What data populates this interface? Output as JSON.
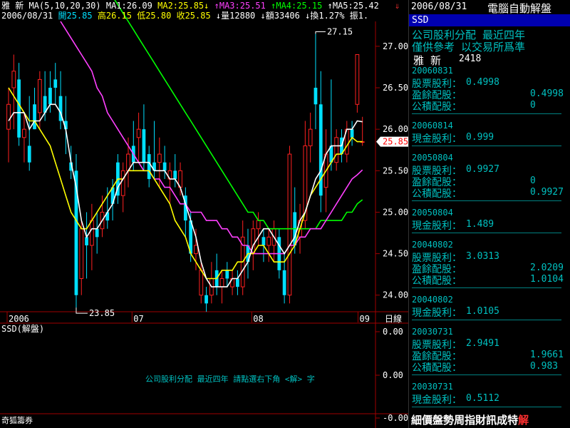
{
  "top_bar": {
    "stock_name": "雅  新",
    "ma_params": "MA(5,10,20,30)",
    "ma1": "MA1:26.09",
    "ma2": "MA2:25.85",
    "ma3": "MA3:25.51",
    "ma4": "MA4:25.15",
    "ma5": "MA5:25.42",
    "date": "2006/08/31",
    "open": "開25.85",
    "high": "高26.15",
    "low": "低25.80",
    "close": "收25.85",
    "volume": "量12880",
    "amount": "額33406",
    "turnover": "換1.27%",
    "amplitude": "振1."
  },
  "price_labels": [
    "27.00",
    "26.50",
    "26.00",
    "25.50",
    "25.00",
    "24.50",
    "24.00"
  ],
  "current_price_tag": "25.85",
  "annotations": {
    "high": "27.15",
    "low": "23.85"
  },
  "x_labels": [
    "2006",
    "07",
    "08",
    "09"
  ],
  "period_label": "日線",
  "lower_panel": {
    "title": "SSD(解盤)",
    "message": "公司股利分配 最近四年  請點選右下角 <解> 字",
    "labels": [
      "0.00",
      "0.00",
      "-0.00"
    ]
  },
  "footer_left": "奇狐籌券",
  "right_panel": {
    "date": "2006/08/31",
    "app_title": "電腦自動解盤",
    "ticker": "SSD",
    "heading1": "公司股利分配  最近四年",
    "heading2": "僅供參考  以交易所爲準",
    "name": "雅  新",
    "code": "2418",
    "records": [
      {
        "date": "20060831",
        "rows": [
          {
            "label": "股票股利：",
            "v1": "0.4998",
            "v2": ""
          },
          {
            "label": "盈餘配股：",
            "v1": "",
            "v2": "0.4998"
          },
          {
            "label": "公積配股：",
            "v1": "",
            "v2": "0"
          }
        ]
      },
      {
        "date": "20060814",
        "rows": [
          {
            "label": "現金股利：",
            "v1": "0.999",
            "v2": ""
          }
        ]
      },
      {
        "date": "20050804",
        "rows": [
          {
            "label": "股票股利：",
            "v1": "0.9927",
            "v2": ""
          },
          {
            "label": "盈餘配股：",
            "v1": "",
            "v2": "0"
          },
          {
            "label": "公積配股：",
            "v1": "",
            "v2": "0.9927"
          }
        ]
      },
      {
        "date": "20050804",
        "rows": [
          {
            "label": "現金股利：",
            "v1": "1.489",
            "v2": ""
          }
        ]
      },
      {
        "date": "20040802",
        "rows": [
          {
            "label": "股票股利：",
            "v1": "3.0313",
            "v2": ""
          },
          {
            "label": "盈餘配股：",
            "v1": "",
            "v2": "2.0209"
          },
          {
            "label": "公積配股：",
            "v1": "",
            "v2": "1.0104"
          }
        ]
      },
      {
        "date": "20040802",
        "rows": [
          {
            "label": "現金股利：",
            "v1": "1.0105",
            "v2": ""
          }
        ]
      },
      {
        "date": "20030731",
        "rows": [
          {
            "label": "股票股利：",
            "v1": "2.9491",
            "v2": ""
          },
          {
            "label": "盈餘配股：",
            "v1": "",
            "v2": "1.9661"
          },
          {
            "label": "公積配股：",
            "v1": "",
            "v2": "0.983"
          }
        ]
      },
      {
        "date": "20030731",
        "rows": [
          {
            "label": "現金股利：",
            "v1": "0.5112",
            "v2": ""
          }
        ]
      }
    ]
  },
  "bottom_menu": [
    "細",
    "價",
    "盤",
    "勢",
    "周",
    "指",
    "財",
    "訊",
    "成",
    "特",
    "解"
  ],
  "colors": {
    "up": "#ff2020",
    "down": "#00e0ff",
    "ma1": "#ffffff",
    "ma2": "#ffff00",
    "ma3": "#ff40ff",
    "ma4": "#00ff00",
    "panel_text": "#00c0c0",
    "menu_active": "#ff3030"
  },
  "chart_data": {
    "type": "candlestick",
    "y_range": [
      23.8,
      27.3
    ],
    "candles": [
      {
        "o": 26.0,
        "h": 26.5,
        "l": 25.6,
        "c": 26.3
      },
      {
        "o": 26.5,
        "h": 26.9,
        "l": 26.0,
        "c": 26.7
      },
      {
        "o": 26.6,
        "h": 26.8,
        "l": 25.8,
        "c": 25.9
      },
      {
        "o": 25.9,
        "h": 26.2,
        "l": 25.6,
        "c": 26.0
      },
      {
        "o": 25.8,
        "h": 26.4,
        "l": 25.5,
        "c": 25.6
      },
      {
        "o": 26.3,
        "h": 26.5,
        "l": 26.0,
        "c": 26.0
      },
      {
        "o": 26.2,
        "h": 26.7,
        "l": 26.0,
        "c": 26.6
      },
      {
        "o": 26.4,
        "h": 26.7,
        "l": 26.1,
        "c": 26.2
      },
      {
        "o": 26.5,
        "h": 26.7,
        "l": 26.2,
        "c": 26.3
      },
      {
        "o": 26.6,
        "h": 26.8,
        "l": 26.3,
        "c": 26.5
      },
      {
        "o": 26.4,
        "h": 26.7,
        "l": 26.0,
        "c": 26.1
      },
      {
        "o": 26.1,
        "h": 26.4,
        "l": 25.7,
        "c": 26.0
      },
      {
        "o": 25.6,
        "h": 25.8,
        "l": 25.4,
        "c": 25.5
      },
      {
        "o": 25.5,
        "h": 25.7,
        "l": 23.85,
        "c": 24.0
      },
      {
        "o": 24.2,
        "h": 24.9,
        "l": 24.0,
        "c": 24.8
      },
      {
        "o": 24.7,
        "h": 25.0,
        "l": 24.2,
        "c": 24.6
      },
      {
        "o": 24.6,
        "h": 25.1,
        "l": 24.3,
        "c": 24.9
      },
      {
        "o": 24.8,
        "h": 25.0,
        "l": 24.5,
        "c": 24.7
      },
      {
        "o": 24.8,
        "h": 25.2,
        "l": 24.7,
        "c": 25.0
      },
      {
        "o": 25.0,
        "h": 25.3,
        "l": 24.8,
        "c": 24.9
      },
      {
        "o": 25.3,
        "h": 25.4,
        "l": 24.9,
        "c": 25.1
      },
      {
        "o": 25.6,
        "h": 25.7,
        "l": 25.1,
        "c": 25.2
      },
      {
        "o": 25.2,
        "h": 25.6,
        "l": 25.0,
        "c": 25.5
      },
      {
        "o": 25.5,
        "h": 25.9,
        "l": 25.3,
        "c": 25.7
      },
      {
        "o": 25.8,
        "h": 26.1,
        "l": 25.5,
        "c": 25.6
      },
      {
        "o": 25.9,
        "h": 26.2,
        "l": 25.6,
        "c": 26.0
      },
      {
        "o": 26.0,
        "h": 26.3,
        "l": 25.5,
        "c": 25.6
      },
      {
        "o": 25.7,
        "h": 25.8,
        "l": 25.3,
        "c": 25.4
      },
      {
        "o": 25.6,
        "h": 26.1,
        "l": 25.4,
        "c": 25.5
      },
      {
        "o": 25.6,
        "h": 25.9,
        "l": 25.3,
        "c": 25.7
      },
      {
        "o": 25.6,
        "h": 25.8,
        "l": 25.4,
        "c": 25.5
      },
      {
        "o": 25.4,
        "h": 25.6,
        "l": 25.1,
        "c": 25.5
      },
      {
        "o": 25.5,
        "h": 25.7,
        "l": 25.3,
        "c": 25.4
      },
      {
        "o": 25.3,
        "h": 25.6,
        "l": 25.2,
        "c": 25.5
      },
      {
        "o": 25.2,
        "h": 25.3,
        "l": 24.7,
        "c": 24.9
      },
      {
        "o": 24.9,
        "h": 25.0,
        "l": 24.4,
        "c": 24.5
      },
      {
        "o": 24.5,
        "h": 24.8,
        "l": 24.3,
        "c": 24.6
      },
      {
        "o": 24.0,
        "h": 24.4,
        "l": 23.9,
        "c": 24.3
      },
      {
        "o": 24.0,
        "h": 24.1,
        "l": 23.8,
        "c": 23.9
      },
      {
        "o": 24.0,
        "h": 24.4,
        "l": 23.9,
        "c": 24.2
      },
      {
        "o": 24.3,
        "h": 24.5,
        "l": 24.0,
        "c": 24.1
      },
      {
        "o": 24.1,
        "h": 24.3,
        "l": 23.9,
        "c": 24.2
      },
      {
        "o": 24.3,
        "h": 24.4,
        "l": 24.1,
        "c": 24.2
      },
      {
        "o": 24.1,
        "h": 24.3,
        "l": 24.0,
        "c": 24.2
      },
      {
        "o": 24.2,
        "h": 24.3,
        "l": 24.0,
        "c": 24.1
      },
      {
        "o": 24.1,
        "h": 24.9,
        "l": 24.0,
        "c": 24.7
      },
      {
        "o": 24.6,
        "h": 24.8,
        "l": 24.2,
        "c": 24.4
      },
      {
        "o": 24.5,
        "h": 24.9,
        "l": 24.3,
        "c": 24.8
      },
      {
        "o": 24.8,
        "h": 25.0,
        "l": 24.6,
        "c": 24.9
      },
      {
        "o": 24.7,
        "h": 24.8,
        "l": 24.4,
        "c": 24.6
      },
      {
        "o": 24.6,
        "h": 24.8,
        "l": 24.4,
        "c": 24.7
      },
      {
        "o": 24.6,
        "h": 24.9,
        "l": 24.4,
        "c": 24.8
      },
      {
        "o": 24.7,
        "h": 24.8,
        "l": 24.2,
        "c": 24.3
      },
      {
        "o": 24.3,
        "h": 24.5,
        "l": 23.9,
        "c": 24.0
      },
      {
        "o": 24.0,
        "h": 25.8,
        "l": 23.9,
        "c": 25.7
      },
      {
        "o": 25.0,
        "h": 25.3,
        "l": 24.5,
        "c": 24.6
      },
      {
        "o": 24.7,
        "h": 25.1,
        "l": 24.5,
        "c": 24.9
      },
      {
        "o": 24.9,
        "h": 26.1,
        "l": 24.8,
        "c": 25.8
      },
      {
        "o": 25.8,
        "h": 26.2,
        "l": 25.6,
        "c": 26.0
      },
      {
        "o": 26.5,
        "h": 27.15,
        "l": 26.0,
        "c": 26.3
      },
      {
        "o": 26.3,
        "h": 26.7,
        "l": 25.0,
        "c": 25.2
      },
      {
        "o": 25.3,
        "h": 26.0,
        "l": 25.0,
        "c": 25.7
      },
      {
        "o": 25.8,
        "h": 26.6,
        "l": 25.5,
        "c": 25.6
      },
      {
        "o": 25.6,
        "h": 26.0,
        "l": 25.5,
        "c": 25.9
      },
      {
        "o": 25.9,
        "h": 26.0,
        "l": 25.6,
        "c": 25.7
      },
      {
        "o": 25.7,
        "h": 26.1,
        "l": 25.6,
        "c": 26.0
      },
      {
        "o": 26.0,
        "h": 26.1,
        "l": 25.8,
        "c": 25.9
      },
      {
        "o": 26.3,
        "h": 26.9,
        "l": 26.2,
        "c": 26.9
      },
      {
        "o": 25.85,
        "h": 26.15,
        "l": 25.8,
        "c": 25.85
      }
    ],
    "ma1": [
      26.1,
      26.2,
      26.2,
      26.2,
      26.0,
      26.1,
      26.1,
      26.2,
      26.3,
      26.3,
      26.2,
      26.0,
      25.6,
      25.3,
      24.9,
      24.7,
      24.8,
      24.8,
      24.9,
      25.0,
      25.1,
      25.3,
      25.4,
      25.5,
      25.6,
      25.6,
      25.6,
      25.6,
      25.5,
      25.5,
      25.5,
      25.4,
      25.4,
      25.3,
      25.1,
      24.9,
      24.7,
      24.4,
      24.2,
      24.1,
      24.1,
      24.1,
      24.1,
      24.2,
      24.2,
      24.3,
      24.4,
      24.6,
      24.7,
      24.8,
      24.8,
      24.7,
      24.6,
      24.5,
      24.6,
      24.7,
      24.9,
      25.0,
      25.2,
      25.4,
      25.5,
      25.7,
      25.8,
      25.8,
      25.8,
      26.0,
      26.0,
      26.1,
      26.09
    ],
    "ma2": [
      26.5,
      26.4,
      26.3,
      26.2,
      26.1,
      26.1,
      26.0,
      25.9,
      25.8,
      25.6,
      25.4,
      25.2,
      25.0,
      24.9,
      24.8,
      24.8,
      24.9,
      25.0,
      25.1,
      25.2,
      25.3,
      25.4,
      25.4,
      25.5,
      25.5,
      25.5,
      25.5,
      25.5,
      25.4,
      25.3,
      25.2,
      25.1,
      24.9,
      24.8,
      24.7,
      24.5,
      24.4,
      24.3,
      24.2,
      24.2,
      24.2,
      24.3,
      24.3,
      24.3,
      24.4,
      24.4,
      24.5,
      24.5,
      24.6,
      24.6,
      24.5,
      24.4,
      24.4,
      24.4,
      24.5,
      24.6,
      24.8,
      25.0,
      25.2,
      25.3,
      25.4,
      25.5,
      25.6,
      25.7,
      25.7,
      25.8,
      25.9,
      25.85,
      25.85
    ],
    "ma3": [
      27.3,
      27.2,
      27.1,
      27.0,
      26.9,
      26.8,
      26.7,
      26.5,
      26.4,
      26.2,
      26.1,
      26.0,
      25.9,
      25.8,
      25.7,
      25.6,
      25.5,
      25.5,
      25.4,
      25.4,
      25.3,
      25.3,
      25.2,
      25.1,
      25.1,
      25.0,
      25.0,
      25.0,
      24.9,
      24.9,
      24.9,
      24.8,
      24.8,
      24.7,
      24.7,
      24.6,
      24.6,
      24.5,
      24.5,
      24.5,
      24.5,
      24.5,
      24.5,
      24.5,
      24.6,
      24.6,
      24.7,
      24.7,
      24.8,
      24.8,
      24.8,
      24.9,
      25.0,
      25.1,
      25.2,
      25.3,
      25.4,
      25.45,
      25.51
    ],
    "ma4": [
      27.6,
      27.5,
      27.4,
      27.3,
      27.2,
      27.1,
      27.0,
      26.9,
      26.8,
      26.7,
      26.6,
      26.5,
      26.4,
      26.3,
      26.2,
      26.1,
      26.0,
      25.9,
      25.8,
      25.7,
      25.6,
      25.5,
      25.4,
      25.3,
      25.2,
      25.1,
      25.0,
      25.0,
      24.9,
      24.9,
      24.8,
      24.8,
      24.8,
      24.8,
      24.8,
      24.8,
      24.8,
      24.8,
      24.8,
      24.8,
      24.9,
      24.9,
      24.9,
      24.9,
      24.9,
      25.0,
      25.0,
      25.1,
      25.15
    ]
  }
}
